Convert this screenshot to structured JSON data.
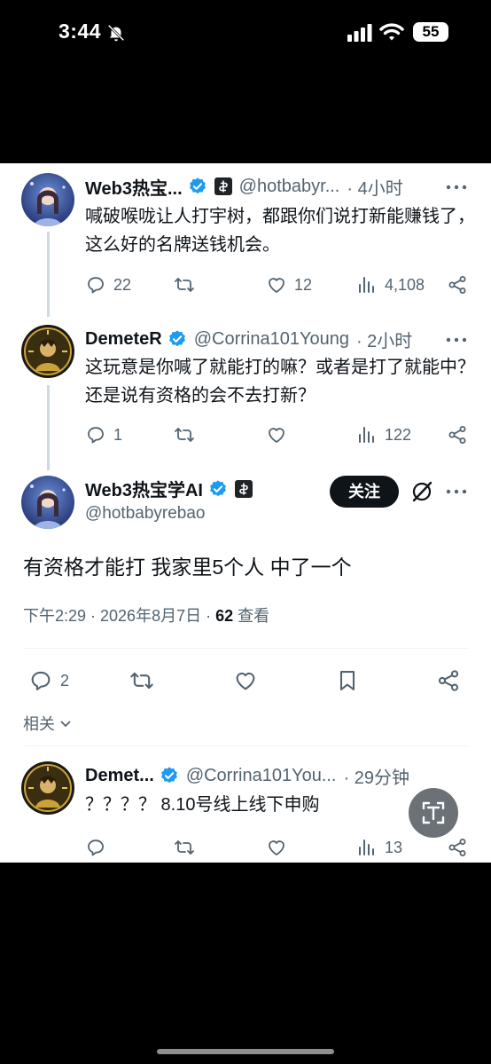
{
  "status_bar": {
    "time": "3:44",
    "battery": "55"
  },
  "tweets": [
    {
      "name": "Web3热宝...",
      "handle": "@hotbabyr...",
      "time": "· 4小时",
      "text": "喊破喉咙让人打宇树，都跟你们说打新能赚钱了，这么好的名牌送钱机会。",
      "replies": "22",
      "retweets": "",
      "likes": "12",
      "views": "4,108"
    },
    {
      "name": "DemeteR",
      "handle": "@Corrina101Young",
      "time": "· 2小时",
      "text": "这玩意是你喊了就能打的嘛？或者是打了就能中？还是说有资格的会不去打新？",
      "replies": "1",
      "retweets": "",
      "likes": "",
      "views": "122"
    }
  ],
  "main_tweet": {
    "name": "Web3热宝学AI",
    "handle": "@hotbabyrebao",
    "follow_label": "关注",
    "text": "有资格才能打 我家里5个人 中了一个",
    "meta_time": "下午2:29 · 2026年8月7日 · ",
    "view_count": "62",
    "view_label": " 查看",
    "replies": "2",
    "related_label": "相关"
  },
  "reply_tweet": {
    "name": "Demet...",
    "handle": "@Corrina101You...",
    "time": "· 29分钟",
    "text": "？？？？ 8.10号线上线下申购",
    "views": "13"
  },
  "colors": {
    "verified": "#1d9bf0",
    "text": "#0f1419",
    "secondary": "#536471",
    "follow_bg": "#0f1419"
  },
  "icons": [
    "reply-icon",
    "retweet-icon",
    "like-icon",
    "views-icon",
    "share-icon",
    "bookmark-icon",
    "verified-icon",
    "more-icon",
    "grok-icon",
    "scan-icon"
  ]
}
